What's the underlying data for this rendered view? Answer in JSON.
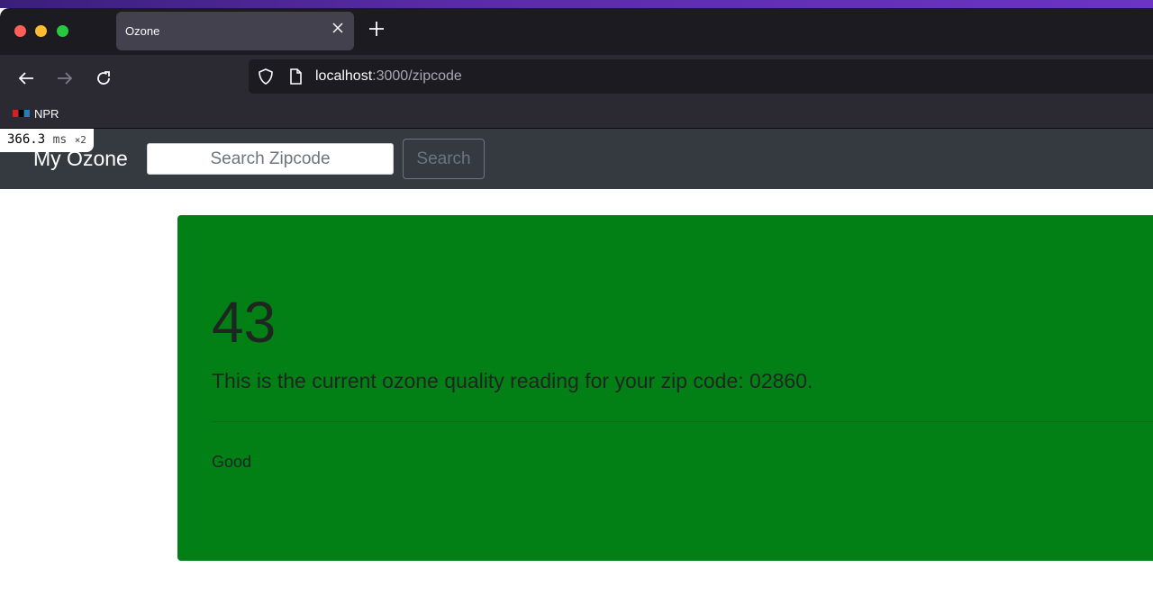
{
  "browser": {
    "tab_title": "Ozone",
    "url_host": "localhost",
    "url_path": ":3000/zipcode",
    "bookmark_label": "NPR",
    "icons": [
      "back-arrow-icon",
      "forward-arrow-icon",
      "reload-icon",
      "shield-icon",
      "page-icon",
      "close-icon",
      "plus-icon"
    ]
  },
  "perf": {
    "value": "366.3",
    "unit": "ms",
    "multiplier": "×2"
  },
  "app": {
    "brand": "My Ozone",
    "search_placeholder": "Search Zipcode",
    "search_button": "Search"
  },
  "reading": {
    "value": "43",
    "description": "This is the current ozone quality reading for your zip code: 02860.",
    "level": "Good",
    "card_color": "#028015"
  }
}
